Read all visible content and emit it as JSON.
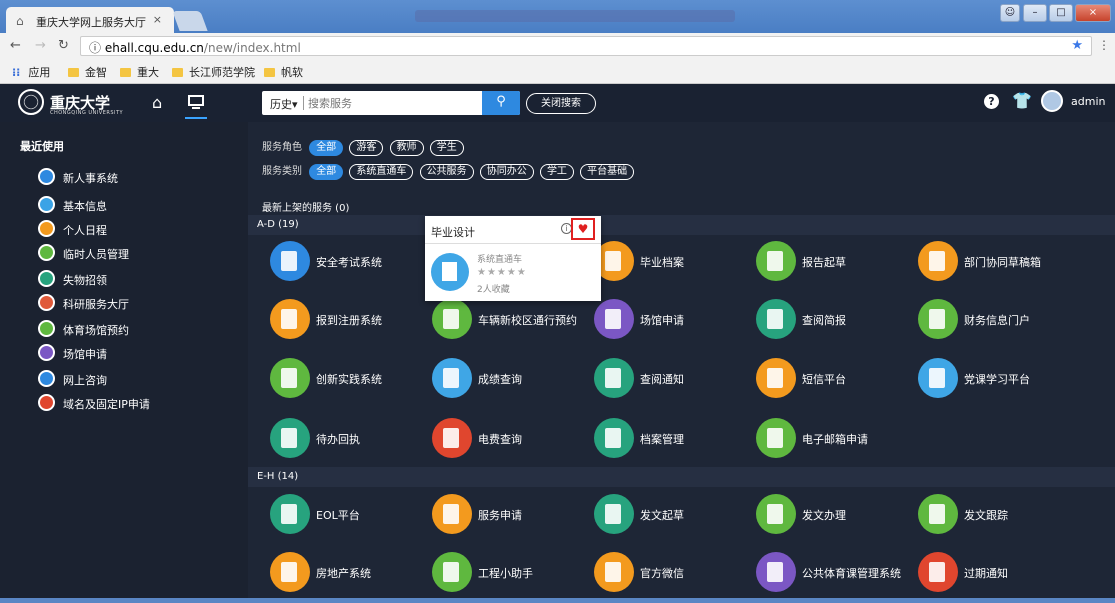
{
  "browser": {
    "tab_title": "重庆大学网上服务大厅",
    "tab_close": "×",
    "url_host": "ehall.cqu.edu.cn",
    "url_path": "/new/index.html",
    "bookmarks": [
      "应用",
      "金智",
      "重大",
      "长江师范学院",
      "帆软"
    ]
  },
  "header": {
    "logo_name": "重庆大学",
    "logo_sub": "CHONGQING UNIVERSITY",
    "history_label": "历史▾",
    "search_placeholder": "搜索服务",
    "close_search_label": "关闭搜索",
    "help_label": "?",
    "username": "admin"
  },
  "sidebar": {
    "title": "最近使用",
    "items": [
      {
        "label": "新人事系统",
        "color": "#2e89e0"
      },
      {
        "label": "基本信息",
        "color": "#3aa3e6"
      },
      {
        "label": "个人日程",
        "color": "#f39a1e"
      },
      {
        "label": "临时人员管理",
        "color": "#5fb83f"
      },
      {
        "label": "失物招领",
        "color": "#27a37e"
      },
      {
        "label": "科研服务大厅",
        "color": "#e05a3a"
      },
      {
        "label": "体育场馆预约",
        "color": "#5fb83f"
      },
      {
        "label": "场馆申请",
        "color": "#7b57c4"
      },
      {
        "label": "网上咨询",
        "color": "#2e89e0"
      },
      {
        "label": "域名及固定IP申请",
        "color": "#e0462e"
      }
    ]
  },
  "filters": {
    "role_label": "服务角色",
    "roles": [
      "全部",
      "游客",
      "教师",
      "学生"
    ],
    "category_label": "服务类别",
    "categories": [
      "全部",
      "系统直通车",
      "公共服务",
      "协同办公",
      "学工",
      "平台基础"
    ]
  },
  "main": {
    "new_services": "最新上架的服务 (0)",
    "group_ad": "A-D (19)",
    "group_eh": "E-H (14)",
    "services": [
      {
        "label": "安全考试系统",
        "color": "#2e89e0"
      },
      {
        "label": "",
        "color": "#3fa6e6"
      },
      {
        "label": "毕业档案",
        "color": "#f39a1e"
      },
      {
        "label": "报告起草",
        "color": "#5fb83f"
      },
      {
        "label": "部门协同草稿箱",
        "color": "#f39a1e"
      },
      {
        "label": "报到注册系统",
        "color": "#f39a1e"
      },
      {
        "label": "车辆新校区通行预约",
        "color": "#5fb83f"
      },
      {
        "label": "场馆申请",
        "color": "#7b57c4"
      },
      {
        "label": "查阅简报",
        "color": "#27a37e"
      },
      {
        "label": "财务信息门户",
        "color": "#5fb83f"
      },
      {
        "label": "创新实践系统",
        "color": "#5fb83f"
      },
      {
        "label": "成绩查询",
        "color": "#3fa6e6"
      },
      {
        "label": "查阅通知",
        "color": "#27a37e"
      },
      {
        "label": "短信平台",
        "color": "#f39a1e"
      },
      {
        "label": "党课学习平台",
        "color": "#3fa6e6"
      },
      {
        "label": "待办回执",
        "color": "#27a37e"
      },
      {
        "label": "电费查询",
        "color": "#e0462e"
      },
      {
        "label": "档案管理",
        "color": "#27a37e"
      },
      {
        "label": "电子邮箱申请",
        "color": "#5fb83f"
      },
      {
        "label": "EOL平台",
        "color": "#27a37e"
      },
      {
        "label": "服务申请",
        "color": "#f39a1e"
      },
      {
        "label": "发文起草",
        "color": "#27a37e"
      },
      {
        "label": "发文办理",
        "color": "#5fb83f"
      },
      {
        "label": "发文跟踪",
        "color": "#5fb83f"
      },
      {
        "label": "房地产系统",
        "color": "#f39a1e"
      },
      {
        "label": "工程小助手",
        "color": "#5fb83f"
      },
      {
        "label": "官方微信",
        "color": "#f39a1e"
      },
      {
        "label": "公共体育课管理系统",
        "color": "#7b57c4"
      },
      {
        "label": "过期通知",
        "color": "#e0462e"
      }
    ]
  },
  "popup": {
    "title": "毕业设计",
    "category": "系统直通车",
    "stars": "★★★★★",
    "favorites": "2人收藏",
    "info_glyph": "i",
    "heart_glyph": "♥"
  }
}
